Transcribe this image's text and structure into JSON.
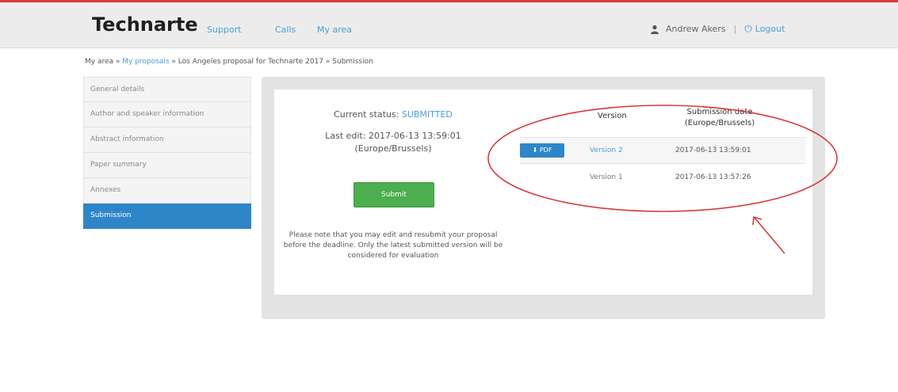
{
  "header": {
    "brand": "Technarte",
    "nav": [
      "Support",
      "Calls",
      "My area"
    ],
    "user_name": "Andrew Akers",
    "separator": "|",
    "logout_label": "Logout"
  },
  "breadcrumb": {
    "root": "My area",
    "sep1": " » ",
    "proposals": "My proposals",
    "sep2": " » ",
    "proposal": "Los Angeles proposal for Technarte 2017",
    "sep3": " » ",
    "current": "Submission"
  },
  "sidebar": {
    "items": [
      {
        "label": "General details"
      },
      {
        "label": "Author and speaker information"
      },
      {
        "label": "Abstract information"
      },
      {
        "label": "Paper summary"
      },
      {
        "label": "Annexes"
      },
      {
        "label": "Submission"
      }
    ]
  },
  "status": {
    "label": "Current status: ",
    "value": "SUBMITTED",
    "last_edit_line1": "Last edit: 2017-06-13 13:59:01",
    "last_edit_line2": "(Europe/Brussels)",
    "submit_label": "Submit",
    "note": "Please note that you may edit and resubmit your proposal before the deadline. Only the latest submitted version will be considered for evaluation"
  },
  "versions": {
    "col_version": "Version",
    "col_date_line1": "Submission date",
    "col_date_line2": "(Europe/Brussels)",
    "pdf_label": "PDF",
    "rows": [
      {
        "version": "Version 2",
        "date": "2017-06-13 13:59:01"
      },
      {
        "version": "Version 1",
        "date": "2017-06-13 13:57:26"
      }
    ]
  },
  "colors": {
    "accent": "#2e86c8",
    "link": "#4aa0d5",
    "submit_green": "#4cae4f",
    "annotation_red": "#d63a3a"
  }
}
